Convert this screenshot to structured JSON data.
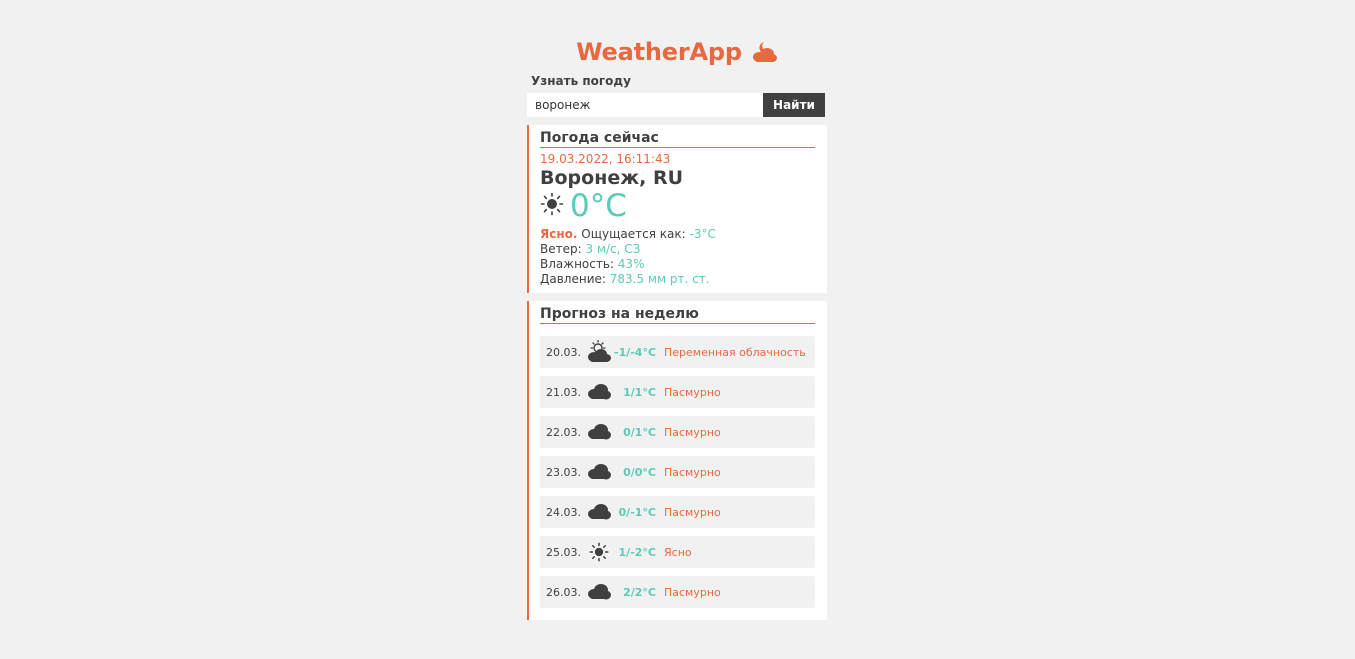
{
  "header": {
    "brand": "WeatherApp",
    "brand_icon": "cloud-moon-icon"
  },
  "search": {
    "label": "Узнать погоду",
    "value": "воронеж",
    "button_label": "Найти"
  },
  "current": {
    "title": "Погода сейчас",
    "datetime": "19.03.2022, 16:11:43",
    "city": "Воронеж, RU",
    "icon": "sun-icon",
    "temperature": "0°C",
    "condition": "Ясно.",
    "feels_like_label": "Ощущается как:",
    "feels_like_value": "-3°C",
    "wind_label": "Ветер:",
    "wind_value": "3 м/с, СЗ",
    "humidity_label": "Влажность:",
    "humidity_value": "43%",
    "pressure_label": "Давление:",
    "pressure_value": "783.5 мм рт. ст."
  },
  "forecast": {
    "title": "Прогноз на неделю",
    "days": [
      {
        "date": "20.03.",
        "icon": "partly-cloudy-icon",
        "temp": "-1/-4°C",
        "desc": "Переменная облачность"
      },
      {
        "date": "21.03.",
        "icon": "cloud-icon",
        "temp": "1/1°C",
        "desc": "Пасмурно"
      },
      {
        "date": "22.03.",
        "icon": "cloud-icon",
        "temp": "0/1°C",
        "desc": "Пасмурно"
      },
      {
        "date": "23.03.",
        "icon": "cloud-icon",
        "temp": "0/0°C",
        "desc": "Пасмурно"
      },
      {
        "date": "24.03.",
        "icon": "cloud-icon",
        "temp": "0/-1°C",
        "desc": "Пасмурно"
      },
      {
        "date": "25.03.",
        "icon": "sun-icon",
        "temp": "1/-2°C",
        "desc": "Ясно"
      },
      {
        "date": "26.03.",
        "icon": "cloud-icon",
        "temp": "2/2°C",
        "desc": "Пасмурно"
      }
    ]
  },
  "colors": {
    "accent": "#e8683f",
    "teal": "#5bcab7",
    "dark": "#404040",
    "background": "#f1f1f1"
  }
}
